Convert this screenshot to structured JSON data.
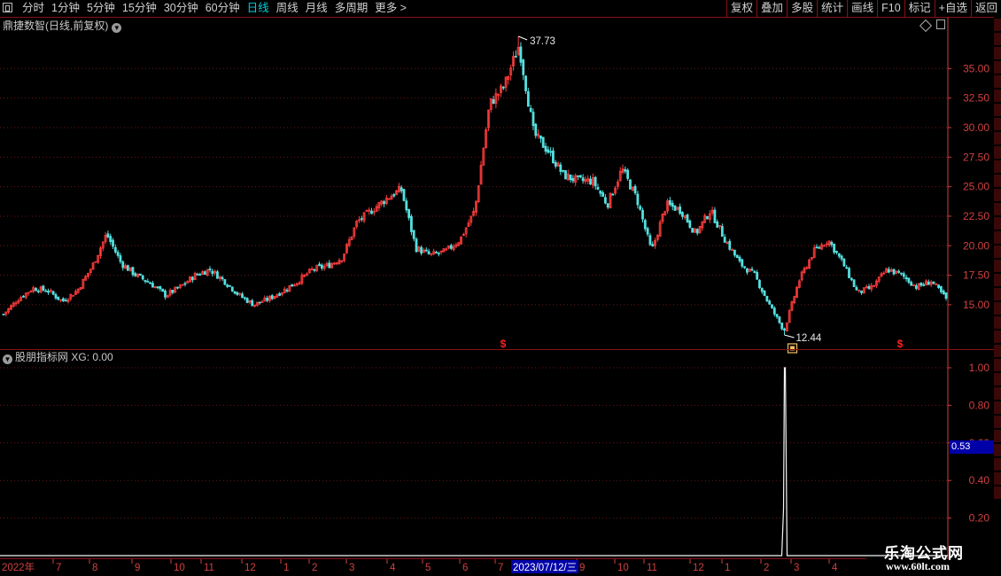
{
  "toolbar": {
    "periods": [
      "分时",
      "1分钟",
      "5分钟",
      "15分钟",
      "30分钟",
      "60分钟",
      "日线",
      "周线",
      "月线",
      "多周期",
      "更多 >"
    ],
    "active_period": "日线",
    "tools": [
      "复权",
      "叠加",
      "多股",
      "统计",
      "画线",
      "F10",
      "标记",
      "+自选",
      "返回"
    ]
  },
  "main_panel": {
    "title": "鼎捷数智(日线,前复权)",
    "y_ticks": [
      "35.00",
      "32.50",
      "30.00",
      "27.50",
      "25.00",
      "22.50",
      "20.00",
      "17.50",
      "15.00"
    ],
    "high_label": "37.73",
    "low_label": "12.44",
    "signal_marker": "$"
  },
  "sub_panel": {
    "title": "股朋指标网",
    "indicator": "XG: 0.00",
    "y_ticks": [
      "1.00",
      "0.80",
      "0.60",
      "0.40",
      "0.20"
    ],
    "cursor_value": "0.53"
  },
  "date_axis": {
    "labels": [
      "2022年",
      "7",
      "8",
      "9",
      "10",
      "11",
      "12",
      "1",
      "2",
      "3",
      "4",
      "5",
      "6",
      "7",
      "9",
      "10",
      "11",
      "12",
      "1",
      "2",
      "3",
      "4"
    ],
    "cursor_date": "2023/07/12/三"
  },
  "watermark": {
    "line1": "乐淘公式网",
    "line2": "www.60lt.com"
  },
  "colors": {
    "up": "#ff3c3c",
    "down": "#54e0e0",
    "axis": "#d04040",
    "grid": "#6a1818",
    "cursor_bg": "#0000a8"
  },
  "chart_data": [
    {
      "type": "candlestick",
      "title": "鼎捷数智(日线,前复权)",
      "ylim": [
        12.44,
        37.73
      ],
      "y_ticks": [
        15.0,
        17.5,
        20.0,
        22.5,
        25.0,
        27.5,
        30.0,
        32.5,
        35.0
      ],
      "x_labels": [
        "2022年",
        "7",
        "8",
        "9",
        "10",
        "11",
        "12",
        "1",
        "2",
        "3",
        "4",
        "5",
        "6",
        "7",
        "9",
        "10",
        "11",
        "12",
        "1",
        "2",
        "3",
        "4"
      ],
      "trend_close": [
        14.2,
        15.5,
        16.4,
        16.2,
        15.3,
        16.2,
        18.2,
        21.0,
        18.5,
        17.5,
        16.8,
        15.8,
        16.5,
        17.5,
        18.0,
        17.0,
        15.8,
        15.0,
        15.5,
        16.2,
        17.0,
        18.0,
        18.3,
        19.0,
        22.0,
        23.0,
        24.0,
        24.8,
        19.8,
        19.2,
        19.5,
        20.5,
        23.0,
        32.0,
        33.5,
        37.0,
        29.5,
        28.0,
        26.0,
        25.5,
        25.5,
        23.5,
        26.5,
        24.0,
        19.5,
        23.5,
        23.0,
        21.0,
        23.0,
        20.5,
        18.5,
        17.5,
        15.0,
        12.8,
        17.0,
        19.5,
        20.5,
        18.5,
        16.0,
        16.5,
        18.0,
        17.5,
        16.5,
        17.0,
        15.5
      ],
      "high": 37.73,
      "low": 12.44
    },
    {
      "type": "line",
      "title": "股朋指标网",
      "series": [
        {
          "name": "XG",
          "last_value": 0.0,
          "spike_value": 1.0
        }
      ],
      "ylim": [
        0,
        1.0
      ],
      "y_ticks": [
        0.2,
        0.4,
        0.6,
        0.8,
        1.0
      ]
    }
  ]
}
